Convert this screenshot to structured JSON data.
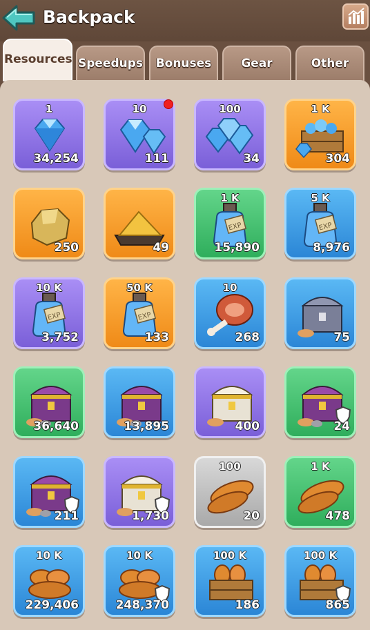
{
  "header": {
    "title": "Backpack"
  },
  "tabs": [
    {
      "label": "Resources"
    },
    {
      "label": "Speedups"
    },
    {
      "label": "Bonuses"
    },
    {
      "label": "Gear"
    },
    {
      "label": "Other"
    }
  ],
  "items": [
    {
      "name": "diamond-1",
      "color": "purple",
      "icon": "diamond-icon",
      "amount": "1",
      "count": "34,254"
    },
    {
      "name": "diamond-10",
      "color": "purple",
      "icon": "diamond-pair-icon",
      "amount": "10",
      "count": "111",
      "new": true
    },
    {
      "name": "diamond-100",
      "color": "purple",
      "icon": "diamond-pile-icon",
      "amount": "100",
      "count": "34"
    },
    {
      "name": "diamond-1k",
      "color": "orange",
      "icon": "diamond-crate-icon",
      "amount": "1 K",
      "count": "304"
    },
    {
      "name": "gold-ore",
      "color": "orange",
      "icon": "gold-ore-icon",
      "amount": "",
      "count": "250"
    },
    {
      "name": "gold-dust",
      "color": "orange",
      "icon": "gold-dust-tray-icon",
      "amount": "",
      "count": "49"
    },
    {
      "name": "exp-1k",
      "color": "green",
      "icon": "exp-potion-icon",
      "amount": "1 K",
      "count": "15,890"
    },
    {
      "name": "exp-5k",
      "color": "blue",
      "icon": "exp-potion-icon",
      "amount": "5 K",
      "count": "8,976"
    },
    {
      "name": "exp-10k",
      "color": "purple",
      "icon": "exp-potion-icon",
      "amount": "10 K",
      "count": "3,752"
    },
    {
      "name": "exp-50k",
      "color": "orange",
      "icon": "exp-potion-icon",
      "amount": "50 K",
      "count": "133"
    },
    {
      "name": "meat-10",
      "color": "blue",
      "icon": "meat-leg-icon",
      "amount": "10",
      "count": "268"
    },
    {
      "name": "chest-silver",
      "color": "blue",
      "icon": "silver-chest-icon",
      "amount": "",
      "count": "75"
    },
    {
      "name": "chest-green",
      "color": "green",
      "icon": "purple-chest-icon",
      "amount": "",
      "count": "36,640"
    },
    {
      "name": "chest-blue",
      "color": "blue",
      "icon": "purple-chest-icon",
      "amount": "",
      "count": "13,895"
    },
    {
      "name": "chest-white",
      "color": "purple",
      "icon": "white-chest-icon",
      "amount": "",
      "count": "400"
    },
    {
      "name": "chest-green-protected",
      "color": "green",
      "icon": "purple-chest-icon",
      "amount": "",
      "count": "24",
      "shield": true
    },
    {
      "name": "chest-blue-protected",
      "color": "blue",
      "icon": "purple-chest-icon",
      "amount": "",
      "count": "211",
      "shield": true
    },
    {
      "name": "chest-white-protected",
      "color": "purple",
      "icon": "white-chest-icon",
      "amount": "",
      "count": "1,730",
      "shield": true
    },
    {
      "name": "bread-100",
      "color": "gray",
      "icon": "bread-icon",
      "amount": "100",
      "count": "20"
    },
    {
      "name": "bread-1k",
      "color": "green",
      "icon": "bread-icon",
      "amount": "1 K",
      "count": "478"
    },
    {
      "name": "bread-10k",
      "color": "blue",
      "icon": "bread-pile-icon",
      "amount": "10 K",
      "count": "229,406"
    },
    {
      "name": "bread-10k-protected",
      "color": "blue",
      "icon": "bread-pile-icon",
      "amount": "10 K",
      "count": "248,370",
      "shield": true
    },
    {
      "name": "bread-crate-100k",
      "color": "blue",
      "icon": "bread-crate-icon",
      "amount": "100 K",
      "count": "186"
    },
    {
      "name": "bread-crate-100k-protected",
      "color": "blue",
      "icon": "bread-crate-icon",
      "amount": "100 K",
      "count": "865",
      "shield": true
    }
  ]
}
